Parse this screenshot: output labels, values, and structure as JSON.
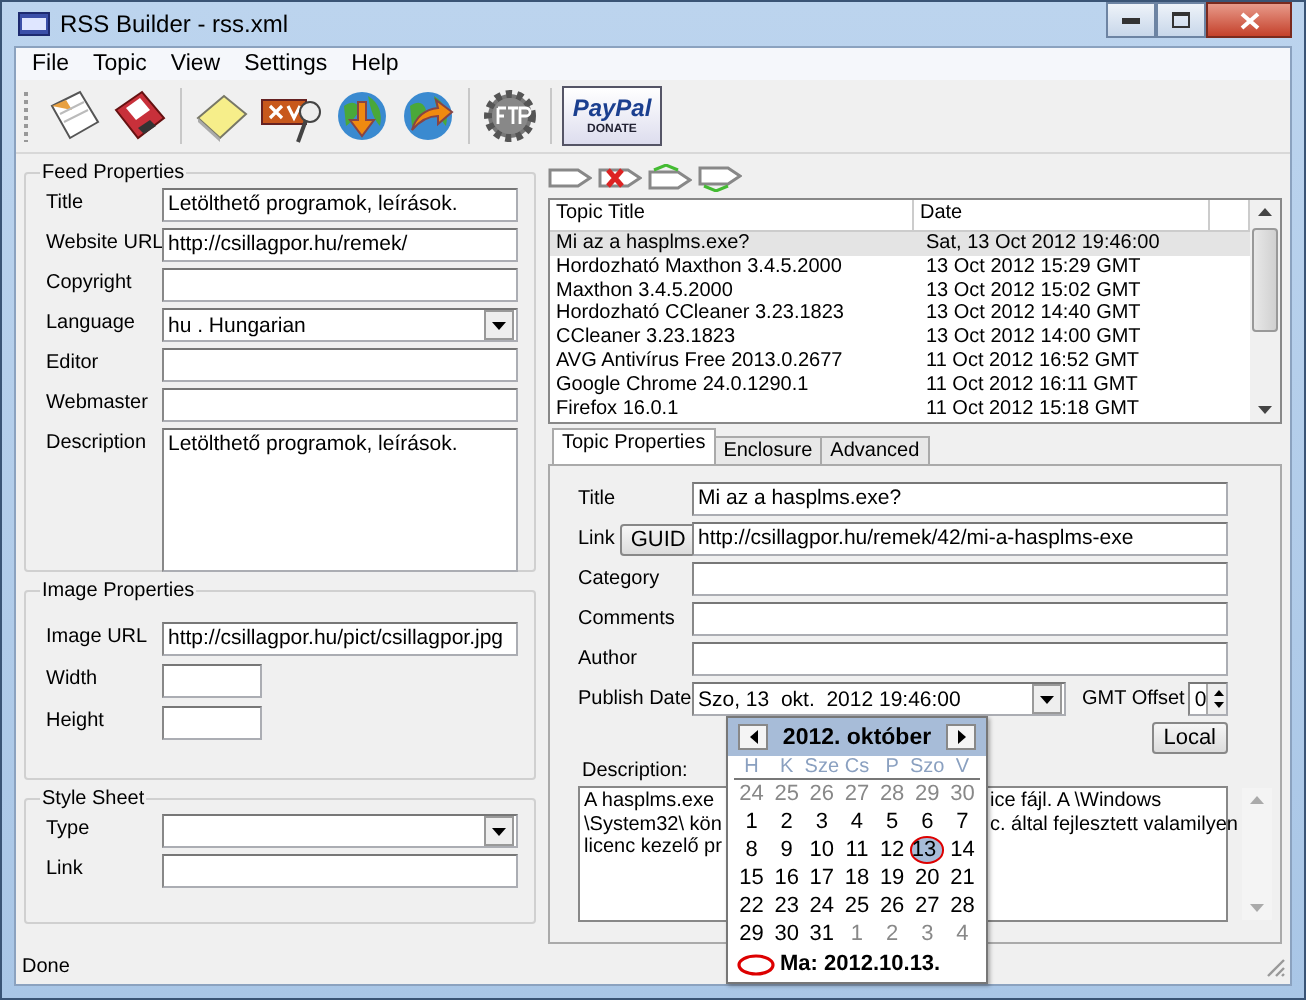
{
  "window": {
    "title": "RSS Builder - rss.xml"
  },
  "menu": [
    "File",
    "Topic",
    "View",
    "Settings",
    "Help"
  ],
  "paypal": {
    "logo": "PayPal",
    "caption": "DONATE"
  },
  "groups": [
    {
      "legend": "Feed Properties",
      "fields": [
        {
          "label": "Title",
          "kind": "text",
          "value": "Letölthető programok, leírások."
        },
        {
          "label": "Website URL",
          "kind": "text",
          "value": "http://csillagpor.hu/remek/"
        },
        {
          "label": "Copyright",
          "kind": "text"
        },
        {
          "label": "Language",
          "kind": "select",
          "value": "hu . Hungarian"
        },
        {
          "label": "Editor",
          "kind": "text"
        },
        {
          "label": "Webmaster",
          "kind": "text"
        },
        {
          "label": "Description",
          "kind": "textarea",
          "value": "Letölthető programok, leírások."
        }
      ]
    },
    {
      "legend": "Image Properties",
      "fields": [
        {
          "label": "Image URL",
          "kind": "text",
          "value": "http://csillagpor.hu/pict/csillagpor.jpg"
        },
        {
          "label": "Width",
          "kind": "short"
        },
        {
          "label": "Height",
          "kind": "short"
        }
      ]
    },
    {
      "legend": "Style Sheet",
      "fields": [
        {
          "label": "Type",
          "kind": "select"
        },
        {
          "label": "Link",
          "kind": "text"
        }
      ]
    }
  ],
  "topics": {
    "columns": [
      "Topic Title",
      "Date"
    ],
    "rows": [
      {
        "title": "Mi az a hasplms.exe?",
        "date": "Sat, 13 Oct 2012 19:46:00",
        "selected": true
      },
      {
        "title": "Hordozható Maxthon 3.4.5.2000",
        "date": "13 Oct 2012 15:29 GMT",
        "selected": false
      },
      {
        "title": "Maxthon 3.4.5.2000",
        "date": "13 Oct 2012 15:02 GMT",
        "selected": false
      },
      {
        "title": "Hordozható CCleaner 3.23.1823",
        "date": "13 Oct 2012 14:40 GMT",
        "selected": false
      },
      {
        "title": "CCleaner 3.23.1823",
        "date": "13 Oct 2012 14:00 GMT",
        "selected": false
      },
      {
        "title": "AVG Antivírus Free 2013.0.2677",
        "date": "11 Oct 2012 16:52 GMT",
        "selected": false
      },
      {
        "title": "Google Chrome 24.0.1290.1",
        "date": "11 Oct 2012 16:11 GMT",
        "selected": false
      },
      {
        "title": "Firefox 16.0.1",
        "date": "11 Oct 2012 15:18 GMT",
        "selected": false
      }
    ]
  },
  "tabs": [
    {
      "label": "Topic Properties",
      "selected": true
    },
    {
      "label": "Enclosure",
      "selected": false
    },
    {
      "label": "Advanced",
      "selected": false
    }
  ],
  "topic_fields": [
    {
      "label": "Title",
      "kind": "text",
      "value": "Mi az a hasplms.exe?"
    },
    {
      "label": "Link",
      "kind": "link",
      "button": "GUID",
      "value": "http://csillagpor.hu/remek/42/mi-a-hasplms-exe"
    },
    {
      "label": "Category",
      "kind": "text"
    },
    {
      "label": "Comments",
      "kind": "text"
    },
    {
      "label": "Author",
      "kind": "text"
    }
  ],
  "publish_date": {
    "label": "Publish Date",
    "value": "Szo, 13  okt.  2012 19:46:00"
  },
  "gmt_offset": {
    "label": "GMT Offset",
    "value": "0"
  },
  "local_button": "Local",
  "description": {
    "label": "Description:",
    "lines": [
      {
        "left": "A hasplms.exe",
        "right": "ice fájl. A \\Windows"
      },
      {
        "left": "\\System32\\ kön",
        "right": "c. által fejlesztett valamilyen"
      },
      {
        "left": "licenc kezelő pr"
      }
    ]
  },
  "calendar": {
    "month": "2012. október",
    "weekdays": [
      "H",
      "K",
      "Sze",
      "Cs",
      "P",
      "Szo",
      "V"
    ],
    "weeks": [
      [
        {
          "day": "24",
          "other": true,
          "selected": false,
          "today": false
        },
        {
          "day": "25",
          "other": true,
          "selected": false,
          "today": false
        },
        {
          "day": "26",
          "other": true,
          "selected": false,
          "today": false
        },
        {
          "day": "27",
          "other": true,
          "selected": false,
          "today": false
        },
        {
          "day": "28",
          "other": true,
          "selected": false,
          "today": false
        },
        {
          "day": "29",
          "other": true,
          "selected": false,
          "today": false
        },
        {
          "day": "30",
          "other": true,
          "selected": false,
          "today": false
        }
      ],
      [
        {
          "day": "1",
          "other": false,
          "selected": false,
          "today": false
        },
        {
          "day": "2",
          "other": false,
          "selected": false,
          "today": false
        },
        {
          "day": "3",
          "other": false,
          "selected": false,
          "today": false
        },
        {
          "day": "4",
          "other": false,
          "selected": false,
          "today": false
        },
        {
          "day": "5",
          "other": false,
          "selected": false,
          "today": false
        },
        {
          "day": "6",
          "other": false,
          "selected": false,
          "today": false
        },
        {
          "day": "7",
          "other": false,
          "selected": false,
          "today": false
        }
      ],
      [
        {
          "day": "8",
          "other": false,
          "selected": false,
          "today": false
        },
        {
          "day": "9",
          "other": false,
          "selected": false,
          "today": false
        },
        {
          "day": "10",
          "other": false,
          "selected": false,
          "today": false
        },
        {
          "day": "11",
          "other": false,
          "selected": false,
          "today": false
        },
        {
          "day": "12",
          "other": false,
          "selected": false,
          "today": false
        },
        {
          "day": "13",
          "other": false,
          "selected": true,
          "today": true
        },
        {
          "day": "14",
          "other": false,
          "selected": false,
          "today": false
        }
      ],
      [
        {
          "day": "15",
          "other": false,
          "selected": false,
          "today": false
        },
        {
          "day": "16",
          "other": false,
          "selected": false,
          "today": false
        },
        {
          "day": "17",
          "other": false,
          "selected": false,
          "today": false
        },
        {
          "day": "18",
          "other": false,
          "selected": false,
          "today": false
        },
        {
          "day": "19",
          "other": false,
          "selected": false,
          "today": false
        },
        {
          "day": "20",
          "other": false,
          "selected": false,
          "today": false
        },
        {
          "day": "21",
          "other": false,
          "selected": false,
          "today": false
        }
      ],
      [
        {
          "day": "22",
          "other": false,
          "selected": false,
          "today": false
        },
        {
          "day": "23",
          "other": false,
          "selected": false,
          "today": false
        },
        {
          "day": "24",
          "other": false,
          "selected": false,
          "today": false
        },
        {
          "day": "25",
          "other": false,
          "selected": false,
          "today": false
        },
        {
          "day": "26",
          "other": false,
          "selected": false,
          "today": false
        },
        {
          "day": "27",
          "other": false,
          "selected": false,
          "today": false
        },
        {
          "day": "28",
          "other": false,
          "selected": false,
          "today": false
        }
      ],
      [
        {
          "day": "29",
          "other": false,
          "selected": false,
          "today": false
        },
        {
          "day": "30",
          "other": false,
          "selected": false,
          "today": false
        },
        {
          "day": "31",
          "other": false,
          "selected": false,
          "today": false
        },
        {
          "day": "1",
          "other": true,
          "selected": false,
          "today": false
        },
        {
          "day": "2",
          "other": true,
          "selected": false,
          "today": false
        },
        {
          "day": "3",
          "other": true,
          "selected": false,
          "today": false
        },
        {
          "day": "4",
          "other": true,
          "selected": false,
          "today": false
        }
      ]
    ],
    "today_label": "Ma: 2012.10.13."
  },
  "status_bar": "Done"
}
